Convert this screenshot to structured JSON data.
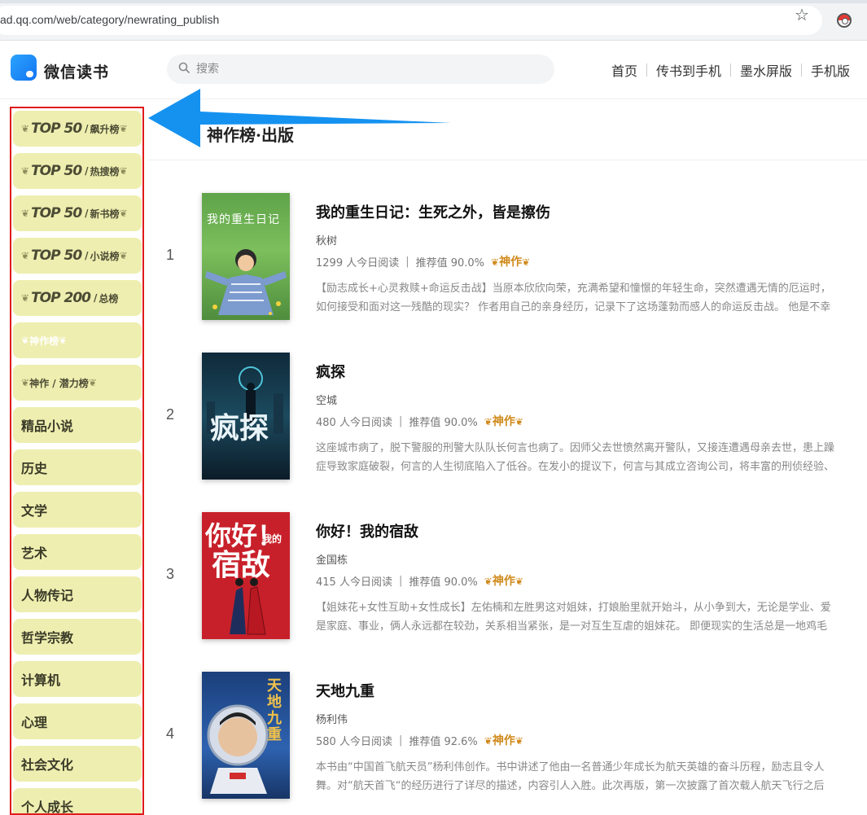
{
  "browser": {
    "url": "ad.qq.com/web/category/newrating_publish"
  },
  "header": {
    "logo_text": "微信读书",
    "search_placeholder": "搜索",
    "nav": [
      "首页",
      "传书到手机",
      "墨水屏版",
      "手机版"
    ]
  },
  "sidebar": {
    "top_items": [
      {
        "num": "TOP 50",
        "name": "飙升榜"
      },
      {
        "num": "TOP 50",
        "name": "热搜榜"
      },
      {
        "num": "TOP 50",
        "name": "新书榜"
      },
      {
        "num": "TOP 50",
        "name": "小说榜"
      },
      {
        "num": "TOP 200",
        "name": "总榜"
      }
    ],
    "shen_items": [
      {
        "label": "神作榜"
      },
      {
        "label": "神作 / 潜力榜"
      }
    ],
    "categories": [
      "精品小说",
      "历史",
      "文学",
      "艺术",
      "人物传记",
      "哲学宗教",
      "计算机",
      "心理",
      "社会文化",
      "个人成长"
    ]
  },
  "main": {
    "page_title": "神作榜·出版",
    "books": [
      {
        "rank": "1",
        "title": "我的重生日记：生死之外，皆是擦伤",
        "author": "秋树",
        "reads": "1299 人今日阅读",
        "rating": "推荐值 90.0%",
        "tag": "神作",
        "desc1": "【励志成长+心灵救赎+命运反击战】当原本欣欣向荣，充满希望和憧憬的年轻生命，突然遭遇无情的厄运时，",
        "desc2": "如何接受和面对这一残酷的现实？ 作者用自己的亲身经历，记录下了这场蓬勃而感人的命运反击战。 他是不幸"
      },
      {
        "rank": "2",
        "title": "疯探",
        "author": "空城",
        "reads": "480 人今日阅读",
        "rating": "推荐值 90.0%",
        "tag": "神作",
        "desc1": "这座城市病了，脱下警服的刑警大队队长何言也病了。因师父去世愤然离开警队，又接连遭遇母亲去世，患上躁",
        "desc2": "症导致家庭破裂，何言的人生彻底陷入了低谷。在发小的提议下，何言与其成立咨询公司，将丰富的刑侦经验、"
      },
      {
        "rank": "3",
        "title": "你好！我的宿敌",
        "author": "金国栋",
        "reads": "415 人今日阅读",
        "rating": "推荐值 90.0%",
        "tag": "神作",
        "desc1": "【姐妹花+女性互助+女性成长】左佑楠和左胜男这对姐妹，打娘胎里就开始斗，从小争到大，无论是学业、爱",
        "desc2": "是家庭、事业，俩人永远都在较劲，关系相当紧张，是一对互生互虐的姐妹花。 即便现实的生活总是一地鸡毛"
      },
      {
        "rank": "4",
        "title": "天地九重",
        "author": "杨利伟",
        "reads": "580 人今日阅读",
        "rating": "推荐值 92.6%",
        "tag": "神作",
        "desc1": "本书由“中国首飞航天员”杨利伟创作。书中讲述了他由一名普通少年成长为航天英雄的奋斗历程，励志且令人",
        "desc2": "舞。对“航天首飞“的经历进行了详尽的描述，内容引人入胜。此次再版，第一次披露了首次载人航天飞行之后"
      }
    ]
  },
  "covers": {
    "c1_text": "我的重生日记",
    "c2_text": "疯探",
    "c3_text1": "你好！",
    "c3_text2": "宿敌",
    "c3_small": "我的",
    "c4_text": "天地九重"
  }
}
